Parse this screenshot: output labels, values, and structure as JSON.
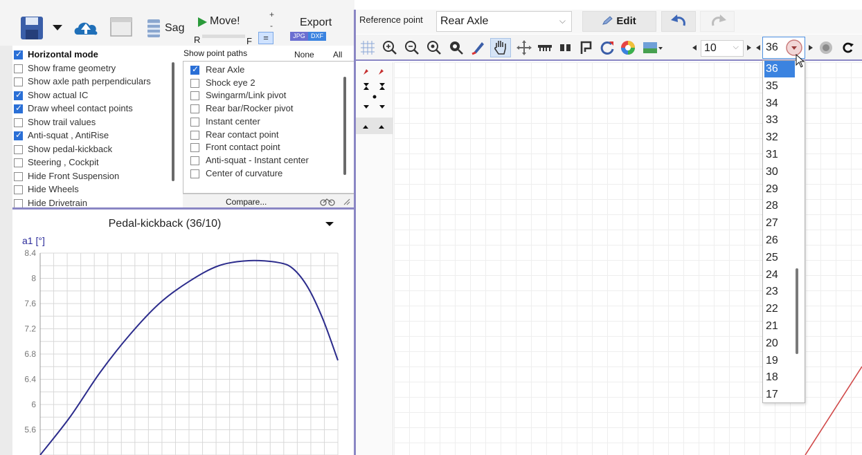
{
  "toolbar": {
    "sag_label": "Sag",
    "move_label": "Move!",
    "r_label": "R",
    "f_label": "F",
    "plus_label": "+",
    "minus_label": "-",
    "eq_label": "=",
    "export_label": "Export",
    "jpg_label": "JPG",
    "dxf_label": "DXF"
  },
  "options": [
    {
      "label": "Horizontal mode",
      "checked": true,
      "bold": true
    },
    {
      "label": "Show frame geometry",
      "checked": false
    },
    {
      "label": "Show axle path perpendiculars",
      "checked": false
    },
    {
      "label": "Show actual IC",
      "checked": true
    },
    {
      "label": "Draw wheel contact points",
      "checked": true
    },
    {
      "label": "Show trail values",
      "checked": false
    },
    {
      "label": "Anti-squat , AntiRise",
      "checked": true
    },
    {
      "label": "Show pedal-kickback",
      "checked": false
    },
    {
      "label": "Steering ,  Cockpit",
      "checked": false
    },
    {
      "label": "Hide Front Suspension",
      "checked": false
    },
    {
      "label": "Hide Wheels",
      "checked": false
    },
    {
      "label": "Hide Drivetrain",
      "checked": false
    }
  ],
  "point_paths": {
    "header": "Show point paths",
    "none_label": "None",
    "all_label": "All",
    "compare_label": "Compare...",
    "items": [
      {
        "label": "Rear Axle",
        "checked": true
      },
      {
        "label": "Shock eye 2",
        "checked": false
      },
      {
        "label": "Swingarm/Link pivot",
        "checked": false
      },
      {
        "label": "Rear bar/Rocker pivot",
        "checked": false
      },
      {
        "label": "Instant center",
        "checked": false
      },
      {
        "label": "Rear contact point",
        "checked": false
      },
      {
        "label": "Front contact point",
        "checked": false
      },
      {
        "label": "Anti-squat - Instant center",
        "checked": false
      },
      {
        "label": "Center of curvature",
        "checked": false
      }
    ]
  },
  "chart_data": {
    "type": "line",
    "title": "Pedal-kickback (36/10)",
    "ylabel": "a1 [°]",
    "xlabel": "",
    "ylim": [
      5.2,
      8.4
    ],
    "yticks": [
      8.4,
      8,
      7.6,
      7.2,
      6.8,
      6.4,
      6,
      5.6
    ],
    "grid": true,
    "series": [
      {
        "x": [
          0.0,
          0.1,
          0.2,
          0.3,
          0.4,
          0.5,
          0.6,
          0.7,
          0.8,
          0.85,
          0.9,
          0.95,
          1.0
        ],
        "values": [
          5.2,
          5.8,
          6.5,
          7.1,
          7.6,
          7.95,
          8.2,
          8.28,
          8.25,
          8.15,
          7.85,
          7.35,
          6.7
        ]
      }
    ]
  },
  "right_toolbar": {
    "reference_label": "Reference point",
    "reference_value": "Rear Axle",
    "edit_label": "Edit",
    "chainring_value": "10",
    "cog_value": "36"
  },
  "dropdown": {
    "selected": "36",
    "items": [
      "36",
      "35",
      "34",
      "33",
      "32",
      "31",
      "30",
      "29",
      "28",
      "27",
      "26",
      "25",
      "24",
      "23",
      "22",
      "21",
      "20",
      "19",
      "18",
      "17"
    ]
  },
  "colors": {
    "accent": "#3b83e0",
    "divider": "#8a86c4",
    "curve": "#2c2c8c",
    "check": "#2a6fd6",
    "canvas_line": "#d04848"
  },
  "icons": [
    "save-icon",
    "cloud-upload-icon",
    "window-icon",
    "battery-icon",
    "play-icon",
    "undo-icon",
    "redo-icon",
    "grid-icon",
    "zoom-in-icon",
    "zoom-out-icon",
    "zoom-fit-icon",
    "zoom-region-icon",
    "brush-icon",
    "hand-icon",
    "move-icon",
    "measure-icon",
    "double-bar-icon",
    "bracket-icon",
    "refresh-icon",
    "color-wheel-icon",
    "landscape-icon",
    "record-icon",
    "rotate-icon"
  ]
}
